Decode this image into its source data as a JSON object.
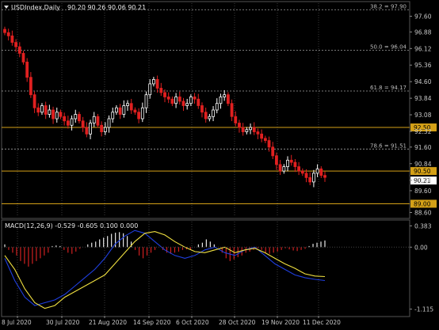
{
  "chart_data": [
    {
      "type": "candlestick",
      "panel": "price",
      "header": {
        "symbol_timeframe": "USDIndex,Daily",
        "ohlc": "90.20 90.26 90.06 90.21"
      },
      "y_ticks": [
        97.6,
        96.88,
        96.12,
        95.36,
        94.6,
        93.84,
        93.08,
        92.32,
        91.6,
        90.84,
        90.08,
        89.6,
        88.6
      ],
      "ylim": [
        88.4,
        98.2
      ],
      "x_ticks": [
        "8 Jul 2020",
        "30 Jul 2020",
        "21 Aug 2020",
        "14 Sep 2020",
        "6 Oct 2020",
        "28 Oct 2020",
        "19 Nov 2020",
        "11 Dec 2020"
      ],
      "fib_levels": [
        {
          "label": "38.2 = 97.90",
          "value": 97.9
        },
        {
          "label": "50.0 = 96.04",
          "value": 96.04
        },
        {
          "label": "61.8 = 94.17",
          "value": 94.17
        },
        {
          "label": "78.6 = 91.51",
          "value": 91.51
        }
      ],
      "horizontal_lines": [
        {
          "label": "92.50",
          "value": 92.5
        },
        {
          "label": "90.50",
          "value": 90.5
        },
        {
          "label": "89.00",
          "value": 89.0
        }
      ],
      "current_price": {
        "label": "90.21",
        "value": 90.21
      },
      "close_path": [
        96.85,
        96.7,
        96.4,
        96.2,
        95.9,
        95.5,
        94.8,
        94.0,
        93.4,
        93.2,
        93.5,
        93.1,
        93.3,
        92.9,
        93.2,
        93.0,
        92.8,
        92.6,
        92.9,
        93.1,
        92.8,
        92.5,
        92.2,
        92.7,
        93.0,
        92.6,
        92.3,
        92.5,
        92.9,
        93.2,
        93.4,
        93.1,
        93.5,
        93.6,
        93.3,
        93.2,
        92.9,
        93.4,
        94.0,
        94.5,
        94.7,
        94.3,
        94.1,
        93.9,
        93.8,
        93.6,
        93.9,
        93.7,
        93.5,
        93.6,
        93.9,
        93.8,
        93.5,
        93.2,
        92.9,
        93.0,
        93.3,
        93.6,
        93.9,
        94.0,
        93.6,
        93.0,
        92.7,
        92.5,
        92.3,
        92.4,
        92.5,
        92.3,
        92.2,
        92.0,
        91.9,
        91.6,
        91.2,
        90.8,
        90.5,
        90.7,
        91.0,
        90.9,
        90.7,
        90.5,
        90.4,
        90.2,
        90.0,
        90.4,
        90.6,
        90.3,
        90.21
      ]
    },
    {
      "type": "macd",
      "panel": "indicator",
      "header": "MACD(12,26,9) -0.529 -0.605 0.100 0.000",
      "y_ticks": [
        0.383,
        0.0,
        -1.115
      ],
      "ylim": [
        -1.22,
        0.46
      ],
      "histogram": [
        0.05,
        -0.05,
        -0.1,
        -0.15,
        -0.25,
        -0.3,
        -0.35,
        -0.3,
        -0.25,
        -0.2,
        -0.15,
        -0.1,
        0.02,
        0.03,
        0.02,
        -0.05,
        -0.1,
        -0.12,
        -0.08,
        -0.03,
        0.0,
        0.05,
        0.08,
        0.1,
        0.14,
        0.17,
        0.2,
        0.24,
        0.26,
        0.27,
        0.25,
        0.2,
        0.1,
        -0.05,
        -0.15,
        -0.2,
        -0.15,
        -0.1,
        -0.05,
        0.0,
        -0.05,
        -0.1,
        -0.12,
        -0.1,
        -0.08,
        -0.05,
        -0.04,
        -0.05,
        0.0,
        0.05,
        0.08,
        0.14,
        0.1,
        0.05,
        0.0,
        -0.1,
        -0.2,
        -0.25,
        -0.22,
        -0.18,
        -0.15,
        -0.1,
        -0.08,
        -0.05,
        -0.02,
        -0.05,
        -0.1,
        -0.12,
        -0.1,
        -0.08,
        -0.05,
        -0.02,
        -0.04,
        -0.06,
        -0.07,
        -0.05,
        -0.03,
        0.02,
        0.06,
        0.08,
        0.1,
        0.12
      ],
      "signal": [
        -0.15,
        -0.4,
        -0.75,
        -1.0,
        -1.1,
        -1.05,
        -0.9,
        -0.8,
        -0.7,
        -0.6,
        -0.5,
        -0.3,
        -0.1,
        0.1,
        0.25,
        0.28,
        0.22,
        0.1,
        0.0,
        -0.08,
        -0.1,
        -0.05,
        0.0,
        -0.1,
        -0.05,
        -0.02,
        -0.1,
        -0.2,
        -0.3,
        -0.38,
        -0.48,
        -0.52,
        -0.53
      ],
      "macd": [
        -0.2,
        -0.6,
        -0.9,
        -1.05,
        -1.0,
        -0.95,
        -0.85,
        -0.7,
        -0.55,
        -0.4,
        -0.2,
        0.05,
        0.2,
        0.3,
        0.25,
        0.1,
        -0.05,
        -0.15,
        -0.2,
        -0.15,
        -0.05,
        0.0,
        -0.1,
        -0.15,
        -0.05,
        0.0,
        -0.15,
        -0.3,
        -0.4,
        -0.5,
        -0.55,
        -0.58,
        -0.6
      ]
    }
  ],
  "colors": {
    "background": "#000000",
    "grid": "#3a3a3a",
    "axis_text": "#c8c8c8",
    "bull_candle": "#ffffff",
    "bear_candle": "#e02020",
    "level_line": "#d4a017",
    "fib_line": "#a0a0a0",
    "macd_line": "#1f3fe0",
    "signal_line": "#f0e040",
    "hist_pos": "#e8e8e8",
    "hist_neg": "#d02020"
  }
}
